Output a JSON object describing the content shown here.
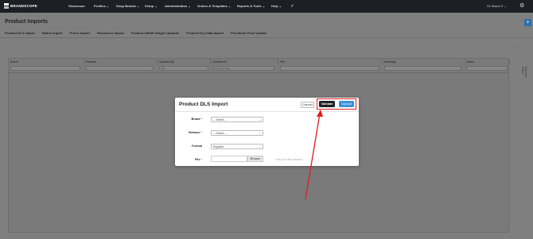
{
  "nav": {
    "logo": "BRANDSCOPE",
    "items": [
      "Showroom",
      "Profiles",
      "Shop Brands",
      "Setup",
      "Administration",
      "Orders & Templates",
      "Reports & Tools",
      "Help"
    ],
    "greeting": "Hi, Brand X"
  },
  "page": {
    "title": "Product Imports",
    "tabs": [
      "Product DLS Import",
      "Status Import",
      "Prices Import",
      "Resources Import",
      "Product sift/tilt Images Uploads",
      "Product Key Data Import",
      "Pricebook Price Update"
    ],
    "active_tab": "Product DLS Import"
  },
  "grid": {
    "columns": [
      "Brand",
      "Release",
      "Updated By",
      "Updated At",
      "File",
      "Message",
      "Status"
    ],
    "filter_values": [
      "",
      "",
      "(All)",
      "Ast Low Image",
      "",
      "",
      ""
    ],
    "side_labels": [
      "Columns",
      "Filters"
    ]
  },
  "modal": {
    "title": "Product DLS Import",
    "cancel": "Cancel",
    "validate": "Validate",
    "upload": "Upload",
    "fields": {
      "brand": {
        "label": "Brand",
        "required": "*",
        "value": "-- Select --"
      },
      "release": {
        "label": "Release",
        "required": "*",
        "value": "-- Select --"
      },
      "format": {
        "label": "Format",
        "value": "Supplier"
      },
      "file": {
        "label": "File",
        "required": "*",
        "browse": "Browse",
        "hint": "Only xxx files allowed"
      }
    }
  },
  "colors": {
    "accent": "#3b8fd8",
    "highlight": "#e01e1e",
    "nav_bg": "#1c1f23"
  }
}
